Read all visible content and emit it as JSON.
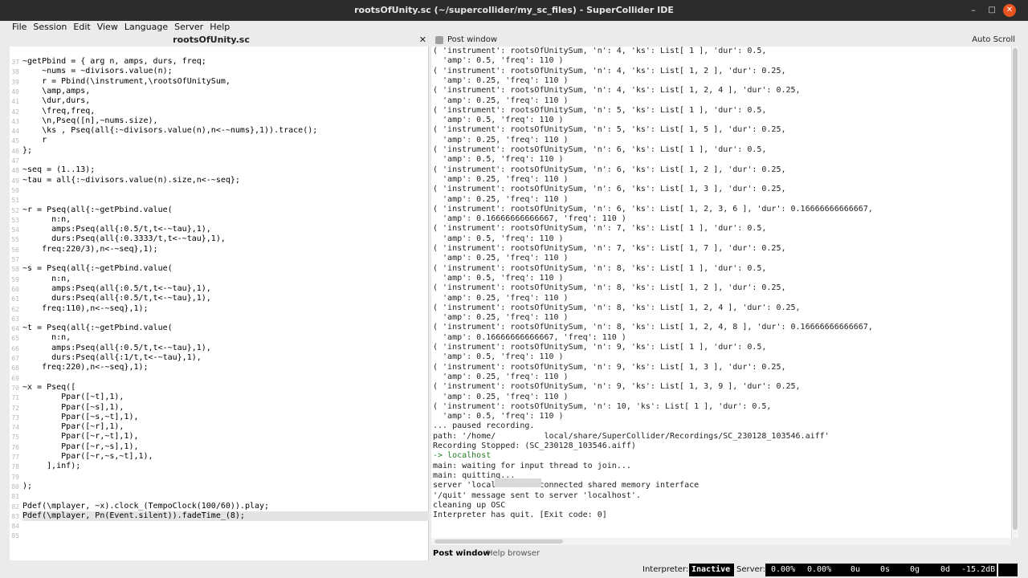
{
  "window": {
    "title": "rootsOfUnity.sc (~/supercollider/my_sc_files) - SuperCollider IDE"
  },
  "menu": [
    "File",
    "Session",
    "Edit",
    "View",
    "Language",
    "Server",
    "Help"
  ],
  "editor": {
    "doc_title": "rootsOfUnity.sc",
    "line_numbers": [
      "37",
      "38",
      "39",
      "40",
      "41",
      "42",
      "43",
      "44",
      "45",
      "46",
      "47",
      "48",
      "49",
      "50",
      "51",
      "52",
      "53",
      "54",
      "55",
      "56",
      "57",
      "58",
      "59",
      "60",
      "61",
      "62",
      "63",
      "64",
      "65",
      "66",
      "67",
      "68",
      "69",
      "70",
      "71",
      "72",
      "73",
      "74",
      "75",
      "76",
      "77",
      "78",
      "79",
      "80",
      "81",
      "82",
      "83",
      "84",
      "85"
    ],
    "lines": [
      "~getPbind = { arg n, amps, durs, freq;",
      "    ~nums = ~divisors.value(n);",
      "    r = Pbind(\\instrument,\\rootsOfUnitySum,",
      "    \\amp,amps,",
      "    \\dur,durs,",
      "    \\freq,freq,",
      "    \\n,Pseq([n],~nums.size),",
      "    \\ks , Pseq(all{:~divisors.value(n),n<-~nums},1)).trace();",
      "    r",
      "};",
      "",
      "~seq = (1..13);",
      "~tau = all{:~divisors.value(n).size,n<-~seq};",
      "",
      "",
      "~r = Pseq(all{:~getPbind.value(",
      "      n:n,",
      "      amps:Pseq(all{:0.5/t,t<-~tau},1),",
      "      durs:Pseq(all{:0.3333/t,t<-~tau},1),",
      "    freq:220/3),n<-~seq},1);",
      "",
      "~s = Pseq(all{:~getPbind.value(",
      "      n:n,",
      "      amps:Pseq(all{:0.5/t,t<-~tau},1),",
      "      durs:Pseq(all{:0.5/t,t<-~tau},1),",
      "    freq:110),n<-~seq},1);",
      "",
      "~t = Pseq(all{:~getPbind.value(",
      "      n:n,",
      "      amps:Pseq(all{:0.5/t,t<-~tau},1),",
      "      durs:Pseq(all{:1/t,t<-~tau},1),",
      "    freq:220),n<-~seq},1);",
      "",
      "~x = Pseq([",
      "        Ppar([~t],1),",
      "        Ppar([~s],1),",
      "        Ppar([~s,~t],1),",
      "        Ppar([~r],1),",
      "        Ppar([~r,~t],1),",
      "        Ppar([~r,~s],1),",
      "        Ppar([~r,~s,~t],1),",
      "     ],inf);",
      "",
      ");",
      "",
      "Pdef(\\mplayer, ~x).clock_(TempoClock(100/60)).play;",
      "Pdef(\\mplayer, Pn(Event.silent)).fadeTime_(8);",
      "",
      ""
    ]
  },
  "post": {
    "header": "Post window",
    "auto_scroll": "Auto Scroll",
    "lines": [
      "( 'instrument': rootsOfUnitySum, 'n': 4, 'ks': List[ 1 ], 'dur': 0.5,",
      "  'amp': 0.5, 'freq': 110 )",
      "( 'instrument': rootsOfUnitySum, 'n': 4, 'ks': List[ 1, 2 ], 'dur': 0.25,",
      "  'amp': 0.25, 'freq': 110 )",
      "( 'instrument': rootsOfUnitySum, 'n': 4, 'ks': List[ 1, 2, 4 ], 'dur': 0.25,",
      "  'amp': 0.25, 'freq': 110 )",
      "( 'instrument': rootsOfUnitySum, 'n': 5, 'ks': List[ 1 ], 'dur': 0.5,",
      "  'amp': 0.5, 'freq': 110 )",
      "( 'instrument': rootsOfUnitySum, 'n': 5, 'ks': List[ 1, 5 ], 'dur': 0.25,",
      "  'amp': 0.25, 'freq': 110 )",
      "( 'instrument': rootsOfUnitySum, 'n': 6, 'ks': List[ 1 ], 'dur': 0.5,",
      "  'amp': 0.5, 'freq': 110 )",
      "( 'instrument': rootsOfUnitySum, 'n': 6, 'ks': List[ 1, 2 ], 'dur': 0.25,",
      "  'amp': 0.25, 'freq': 110 )",
      "( 'instrument': rootsOfUnitySum, 'n': 6, 'ks': List[ 1, 3 ], 'dur': 0.25,",
      "  'amp': 0.25, 'freq': 110 )",
      "( 'instrument': rootsOfUnitySum, 'n': 6, 'ks': List[ 1, 2, 3, 6 ], 'dur': 0.16666666666667,",
      "  'amp': 0.16666666666667, 'freq': 110 )",
      "( 'instrument': rootsOfUnitySum, 'n': 7, 'ks': List[ 1 ], 'dur': 0.5,",
      "  'amp': 0.5, 'freq': 110 )",
      "( 'instrument': rootsOfUnitySum, 'n': 7, 'ks': List[ 1, 7 ], 'dur': 0.25,",
      "  'amp': 0.25, 'freq': 110 )",
      "( 'instrument': rootsOfUnitySum, 'n': 8, 'ks': List[ 1 ], 'dur': 0.5,",
      "  'amp': 0.5, 'freq': 110 )",
      "( 'instrument': rootsOfUnitySum, 'n': 8, 'ks': List[ 1, 2 ], 'dur': 0.25,",
      "  'amp': 0.25, 'freq': 110 )",
      "( 'instrument': rootsOfUnitySum, 'n': 8, 'ks': List[ 1, 2, 4 ], 'dur': 0.25,",
      "  'amp': 0.25, 'freq': 110 )",
      "( 'instrument': rootsOfUnitySum, 'n': 8, 'ks': List[ 1, 2, 4, 8 ], 'dur': 0.16666666666667,",
      "  'amp': 0.16666666666667, 'freq': 110 )",
      "( 'instrument': rootsOfUnitySum, 'n': 9, 'ks': List[ 1 ], 'dur': 0.5,",
      "  'amp': 0.5, 'freq': 110 )",
      "( 'instrument': rootsOfUnitySum, 'n': 9, 'ks': List[ 1, 3 ], 'dur': 0.25,",
      "  'amp': 0.25, 'freq': 110 )",
      "( 'instrument': rootsOfUnitySum, 'n': 9, 'ks': List[ 1, 3, 9 ], 'dur': 0.25,",
      "  'amp': 0.25, 'freq': 110 )",
      "( 'instrument': rootsOfUnitySum, 'n': 10, 'ks': List[ 1 ], 'dur': 0.5,",
      "  'amp': 0.5, 'freq': 110 )",
      "... paused recording.",
      "path: '/home/          local/share/SuperCollider/Recordings/SC_230128_103546.aiff'",
      "Recording Stopped: (SC_230128_103546.aiff)",
      "-> localhost",
      "main: waiting for input thread to join...",
      "main: quitting...",
      "server 'localhost' disconnected shared memory interface",
      "'/quit' message sent to server 'localhost'.",
      "cleaning up OSC",
      "Interpreter has quit. [Exit code: 0]"
    ]
  },
  "tabs": {
    "post": "Post window",
    "help": "Help browser"
  },
  "status": {
    "interpreter_label": "Interpreter:",
    "interpreter_state": "Inactive",
    "server_label": "Server:",
    "cpu_avg": "0.00%",
    "cpu_peak": "0.00%",
    "ugens": "0u",
    "synths": "0s",
    "groups": "0g",
    "defs": "0d",
    "volume": "-15.2dB"
  }
}
